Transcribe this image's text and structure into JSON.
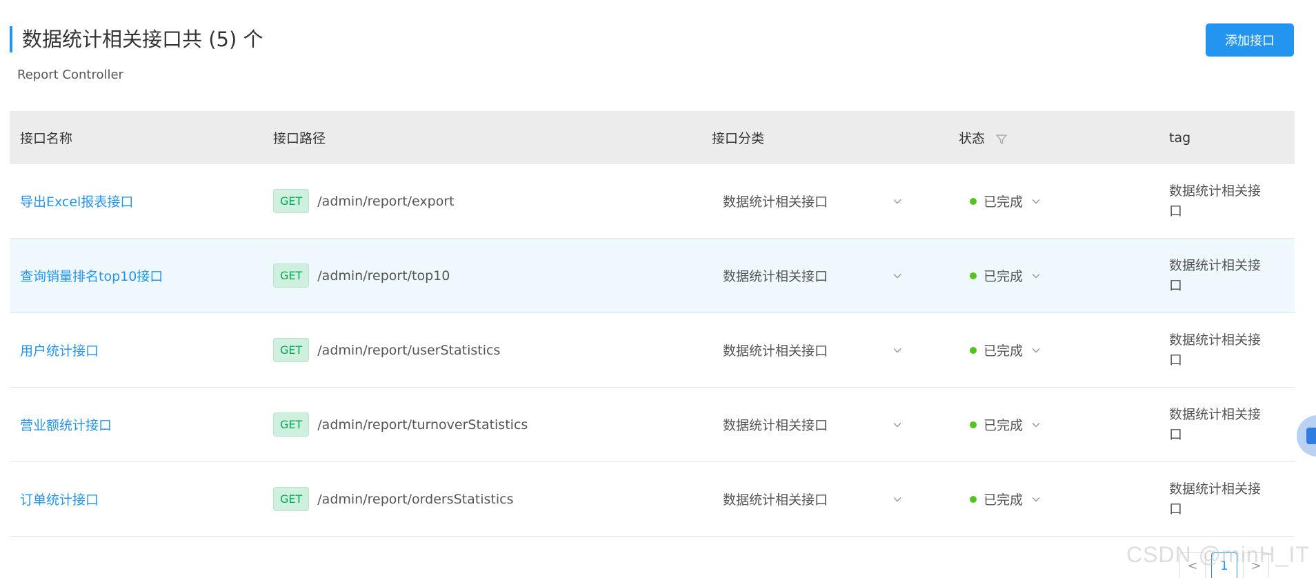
{
  "header": {
    "title": "数据统计相关接口共 (5) 个",
    "subtitle": "Report Controller",
    "add_button": "添加接口"
  },
  "table": {
    "columns": [
      "接口名称",
      "接口路径",
      "接口分类",
      "状态",
      "tag"
    ],
    "rows": [
      {
        "name": "导出Excel报表接口",
        "method": "GET",
        "path": "/admin/report/export",
        "category": "数据统计相关接口",
        "status": "已完成",
        "tag": "数据统计相关接口"
      },
      {
        "name": "查询销量排名top10接口",
        "method": "GET",
        "path": "/admin/report/top10",
        "category": "数据统计相关接口",
        "status": "已完成",
        "tag": "数据统计相关接口"
      },
      {
        "name": "用户统计接口",
        "method": "GET",
        "path": "/admin/report/userStatistics",
        "category": "数据统计相关接口",
        "status": "已完成",
        "tag": "数据统计相关接口"
      },
      {
        "name": "营业额统计接口",
        "method": "GET",
        "path": "/admin/report/turnoverStatistics",
        "category": "数据统计相关接口",
        "status": "已完成",
        "tag": "数据统计相关接口"
      },
      {
        "name": "订单统计接口",
        "method": "GET",
        "path": "/admin/report/ordersStatistics",
        "category": "数据统计相关接口",
        "status": "已完成",
        "tag": "数据统计相关接口"
      }
    ]
  },
  "pagination": {
    "prev": "<",
    "current": "1",
    "next": ">"
  },
  "watermark": "CSDN @minH_IT",
  "colors": {
    "accent": "#2395f1",
    "method_bg": "#cfefdf",
    "method_text": "#00a854",
    "status_dot": "#52c41a",
    "header_bg": "#ececec",
    "highlight_row": "#eef8fd"
  },
  "icons": {
    "filter": "filter-icon",
    "chevron": "chevron-down-icon"
  }
}
